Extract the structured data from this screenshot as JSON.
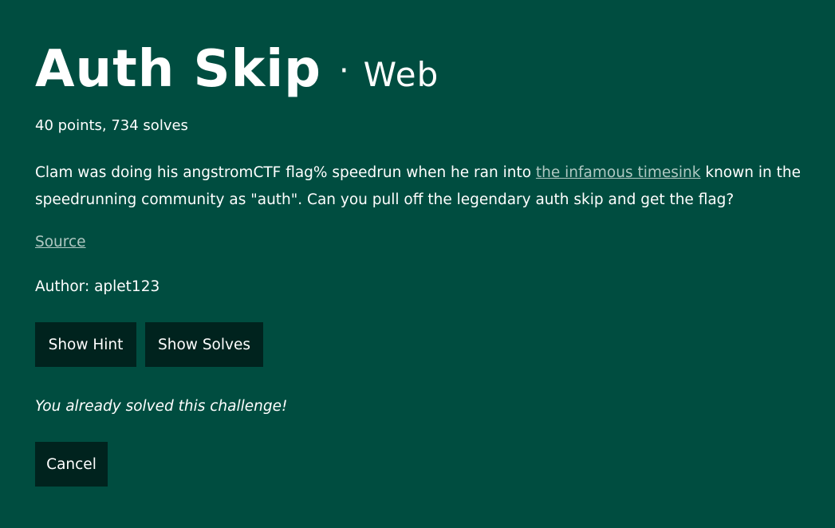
{
  "challenge": {
    "title": "Auth Skip",
    "separator": "·",
    "category": "Web",
    "points_solves": "40 points, 734 solves",
    "description_before_link": "Clam was doing his angstromCTF flag% speedrun when he ran into ",
    "description_link_text": "the infamous timesink",
    "description_after_link": " known in the speedrunning community as \"auth\". Can you pull off the legendary auth skip and get the flag?",
    "source_label": "Source",
    "author": "Author: aplet123"
  },
  "actions": {
    "show_hint_label": "Show Hint",
    "show_solves_label": "Show Solves",
    "cancel_label": "Cancel"
  },
  "status": {
    "solved_message": "You already solved this challenge!"
  },
  "colors": {
    "background": "#004d40",
    "button": "#00231e",
    "link": "#b0c8c2",
    "text": "#ffffff"
  }
}
